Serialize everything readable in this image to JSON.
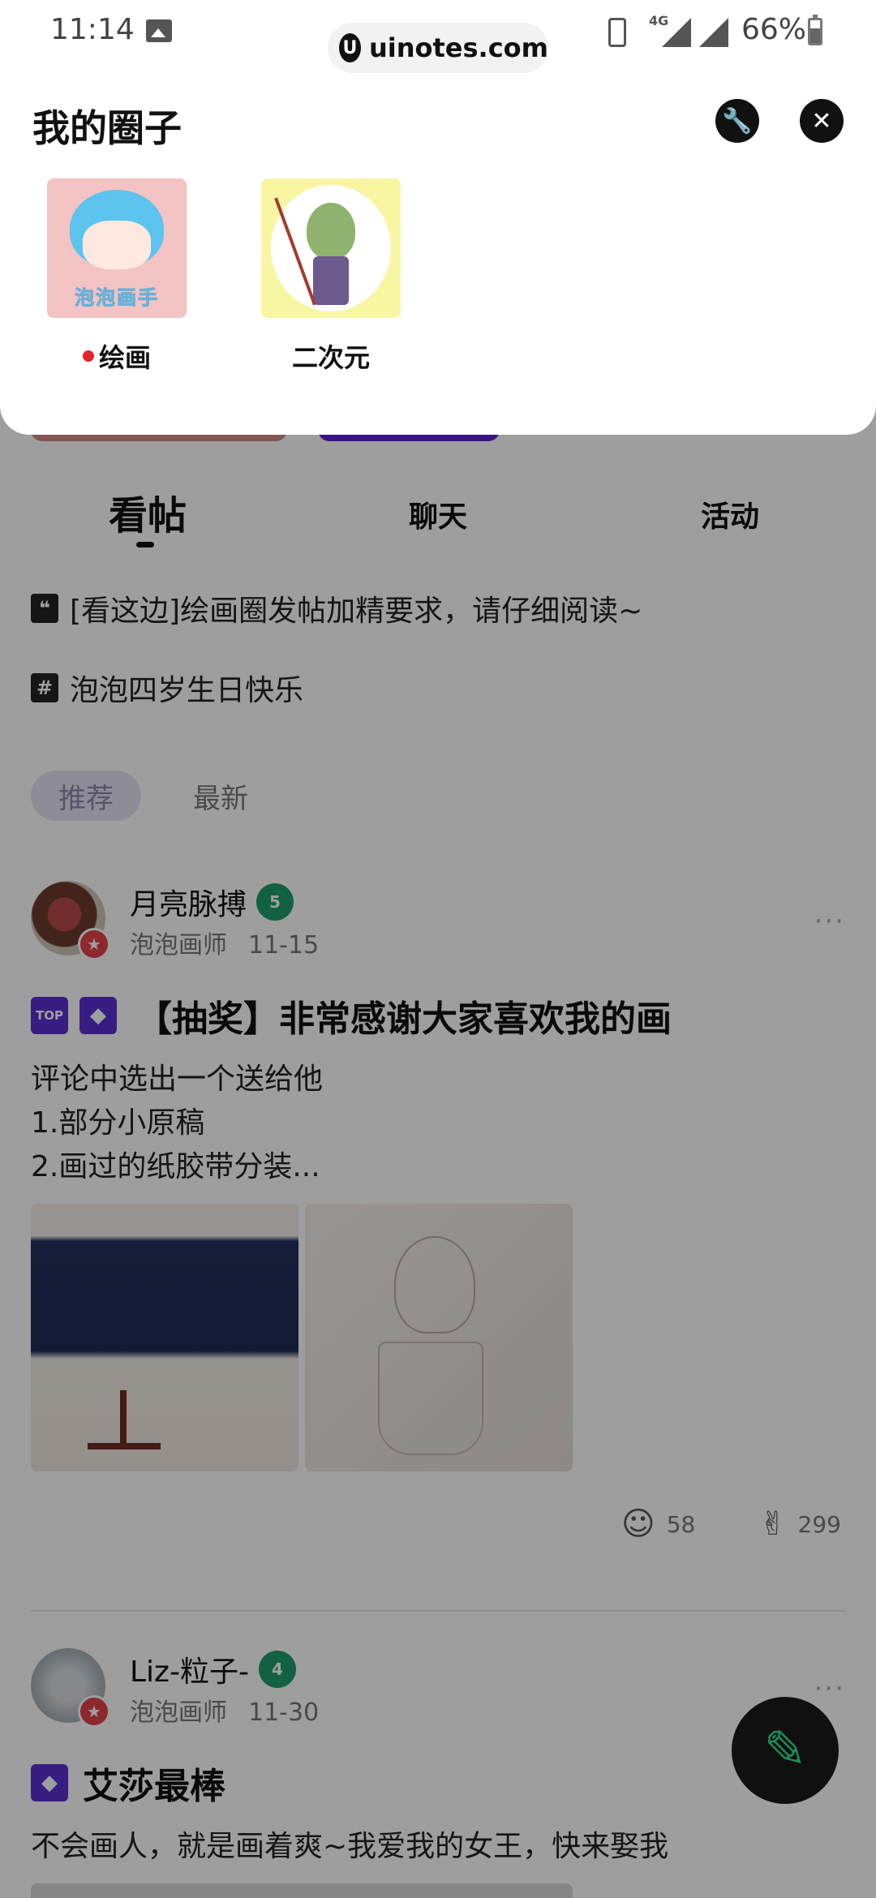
{
  "status_bar": {
    "time": "11:14",
    "network": "4G",
    "battery_percent": "66%",
    "battery_level": 0.66,
    "url": "uinotes.com"
  },
  "circle_tabs": [
    "看帖",
    "聊天",
    "活动"
  ],
  "notices": [
    {
      "icon": "quote-icon",
      "text": "[看这边]绘画圈发帖加精要求，请仔细阅读~"
    },
    {
      "icon": "hashtag-icon",
      "text": "泡泡四岁生日快乐"
    }
  ],
  "filters": [
    "推荐",
    "最新"
  ],
  "posts": [
    {
      "author": "月亮脉搏",
      "level": "5",
      "role": "泡泡画师",
      "date": "11-15",
      "title": "【抽奖】非常感谢大家喜欢我的画",
      "tags": [
        "TOP",
        "◆"
      ],
      "body": [
        "评论中选出一个送给他",
        "1.部分小原稿",
        "2.画过的纸胶带分装..."
      ],
      "comments": "58",
      "likes": "299",
      "more": "···"
    },
    {
      "author": "Liz-粒子-",
      "level": "4",
      "role": "泡泡画师",
      "date": "11-30",
      "title": "艾莎最棒",
      "tags": [
        "◆"
      ],
      "body": [
        "不会画人，就是画着爽~我爱我的女王，快来娶我"
      ],
      "more": "···"
    }
  ],
  "sheet": {
    "title": "我的圈子",
    "circles": [
      {
        "name": "绘画",
        "cover_text": "泡泡画手",
        "unread": true
      },
      {
        "name": "二次元",
        "unread": false
      }
    ]
  },
  "colors": {
    "accent_purple": "#5a2fd0",
    "level_green": "#1e9d6e",
    "badge_red": "#e3424b",
    "fab_icon": "#2de28f"
  }
}
